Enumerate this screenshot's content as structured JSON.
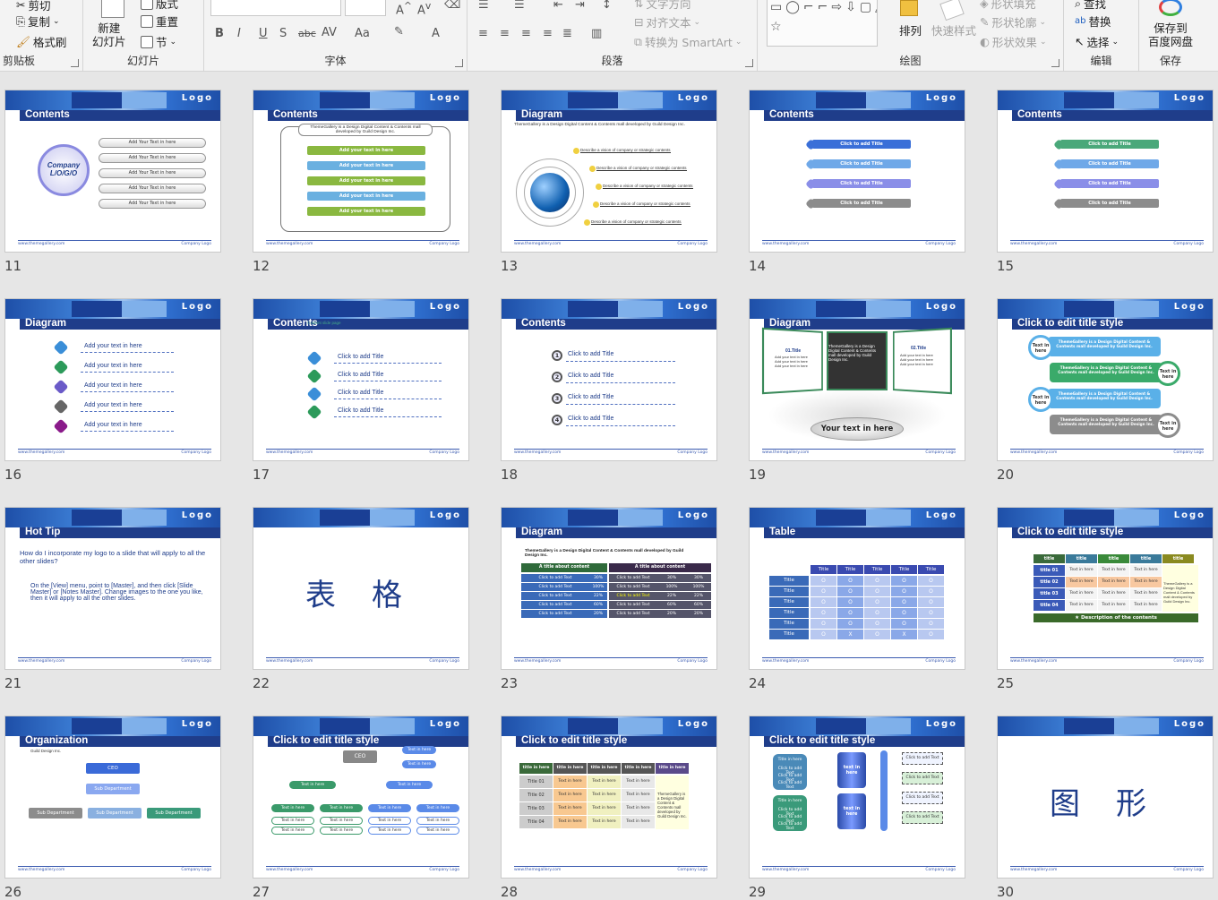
{
  "ribbon": {
    "clipboard": {
      "label": "剪贴板",
      "cut": "剪切",
      "copy": "复制",
      "format_painter": "格式刷"
    },
    "slides": {
      "label": "幻灯片",
      "new_slide": "新建\n幻灯片",
      "layout": "版式",
      "reset": "重置",
      "section": "节"
    },
    "font": {
      "label": "字体"
    },
    "paragraph": {
      "label": "段落",
      "text_direction": "文字方向",
      "align_text": "对齐文本",
      "smartart": "转换为 SmartArt"
    },
    "drawing": {
      "label": "绘图",
      "arrange": "排列",
      "quick_styles": "快速样式",
      "shape_fill": "形状填充",
      "shape_outline": "形状轮廓",
      "shape_effects": "形状效果"
    },
    "editing": {
      "label": "编辑",
      "find": "查找",
      "replace": "替换",
      "select": "选择"
    },
    "save": {
      "label": "保存",
      "save_baidu": "保存到\n百度网盘"
    }
  },
  "slides": [
    {
      "n": "11",
      "title": "Contents",
      "kind": "company",
      "center": "Company\nL/O/G/O",
      "items": [
        "Add Your Text in here",
        "Add Your Text in here",
        "Add Your Text in here",
        "Add Your Text in here",
        "Add Your Text in here"
      ]
    },
    {
      "n": "12",
      "title": "Contents",
      "kind": "greenlist",
      "intro": "ThemeGallery is a Design Digital Content & Contents mall developed by Guild Design Inc.",
      "items": [
        "Add your text in here",
        "Add your text in here",
        "Add your text in here",
        "Add your text in here",
        "Add your text in here"
      ]
    },
    {
      "n": "13",
      "title": "Diagram",
      "kind": "globe",
      "intro": "ThemeGallery is a Design Digital Content & Contents mall developed by Guild Design Inc.",
      "items": [
        "Describe a vision of company or strategic contents",
        "Describe a vision of company or strategic contents",
        "Describe a vision of company or strategic contents",
        "Describe a vision of company or strategic contents",
        "Describe a vision of company or strategic contents"
      ]
    },
    {
      "n": "14",
      "title": "Contents",
      "kind": "arrows",
      "items": [
        "Click to add Title",
        "Click to add Title",
        "Click to add Title",
        "Click to add Title"
      ],
      "colors": [
        "#3a6fd8",
        "#6fa8e8",
        "#8a8ee8",
        "#8c8c8c"
      ]
    },
    {
      "n": "15",
      "title": "Contents",
      "kind": "arrows",
      "items": [
        "Click to add Title",
        "Click to add Title",
        "Click to add Title",
        "Click to add Title"
      ],
      "colors": [
        "#4aa87a",
        "#6fa8e8",
        "#8a8ee8",
        "#8c8c8c"
      ]
    },
    {
      "n": "16",
      "title": "Diagram",
      "kind": "cubes",
      "items": [
        "Add your text in here",
        "Add your text in here",
        "Add your text in here",
        "Add your text in here",
        "Add your text in here"
      ],
      "colors": [
        "#3a8ed8",
        "#2c9a5a",
        "#6a5ac8",
        "#666666",
        "#8a1a8a"
      ]
    },
    {
      "n": "17",
      "title": "Contents",
      "kind": "cubes4",
      "subtitle": "Content slide page",
      "items": [
        "Click to add Title",
        "Click to add Title",
        "Click to add Title",
        "Click to add Title"
      ],
      "colors": [
        "#3a8ed8",
        "#2c9a5a",
        "#3a8ed8",
        "#2c9a5a"
      ]
    },
    {
      "n": "18",
      "title": "Contents",
      "kind": "numbered",
      "items": [
        "Click to add Title",
        "Click to add Title",
        "Click to add Title",
        "Click to add Title"
      ],
      "nums": [
        "1",
        "2",
        "3",
        "4"
      ]
    },
    {
      "n": "19",
      "title": "Diagram",
      "kind": "boards",
      "center": "Your text in here",
      "t1": "01.Title",
      "t2": "02.Title",
      "mid": "ThemeGallery is a Design Digital Content & Contents mall developed by Guild Design Inc.",
      "bullets": [
        "Add your text in here",
        "Add your text in here",
        "Add your text in here"
      ]
    },
    {
      "n": "20",
      "title": "Click to edit title style",
      "kind": "bubbles",
      "tag": "Text in here",
      "body": "ThemeGallery is a Design Digital Content & Contents mall developed by Guild Design Inc.",
      "colors": [
        "#5ab0e8",
        "#3aaa6a",
        "#5ab0e8",
        "#8c8c8c"
      ]
    },
    {
      "n": "21",
      "title": "Hot Tip",
      "kind": "hottip",
      "q": "How do I incorporate my logo to a slide that will apply to all the other slides?",
      "a": "On the [View] menu, point to [Master], and then click [Slide Master] or [Notes Master]. Change images to the one you like, then it will apply to all the other slides."
    },
    {
      "n": "22",
      "title": "",
      "kind": "section",
      "big": "表格"
    },
    {
      "n": "23",
      "title": "Diagram",
      "kind": "table23",
      "intro": "ThemeGallery is a Design Digital Content & Contents mall developed by Guild Design Inc.",
      "h1": "A title about content",
      "h2": "A title about content",
      "row_label": "Click to add Text",
      "vals": [
        "30%",
        "100%",
        "22%",
        "60%",
        "20%"
      ]
    },
    {
      "n": "24",
      "title": "Table",
      "kind": "table24",
      "col": "Title",
      "rowlabel": "Title",
      "mark": "O",
      "x": "X"
    },
    {
      "n": "25",
      "title": "Click to edit title style",
      "kind": "table25",
      "col": "title",
      "rows": [
        "title 01",
        "title 02",
        "title 03",
        "title 04"
      ],
      "cell": "Text in here",
      "desc": "★ Description of the contents",
      "side": "ThemeGallery is a Design Digital Content & Contents mall developed by Guild Design Inc."
    },
    {
      "n": "26",
      "title": "Organization",
      "kind": "org",
      "ceo": "CEO",
      "sub": "Sub Department",
      "intro": "Guild Design Inc."
    },
    {
      "n": "27",
      "title": "Click to edit title style",
      "kind": "tree",
      "ceo": "CEO",
      "t": "Text in here"
    },
    {
      "n": "28",
      "title": "Click to edit title style",
      "kind": "table28",
      "h": "title in here",
      "rows": [
        "Title 01",
        "Title 02",
        "Title 03",
        "Title 04"
      ],
      "cell": "Text in here",
      "side": "ThemeGallery is a Design Digital Content & Contents mall developed by Guild Design Inc."
    },
    {
      "n": "29",
      "title": "Click to edit title style",
      "kind": "cylinders",
      "t": "Click to add Text",
      "title_in": "Title in here",
      "mid": "text in here"
    },
    {
      "n": "30",
      "title": "",
      "kind": "section",
      "big": "图形"
    }
  ],
  "footer": {
    "left": "www.themegallery.com",
    "right": "Company Logo"
  },
  "logo": "Logo"
}
